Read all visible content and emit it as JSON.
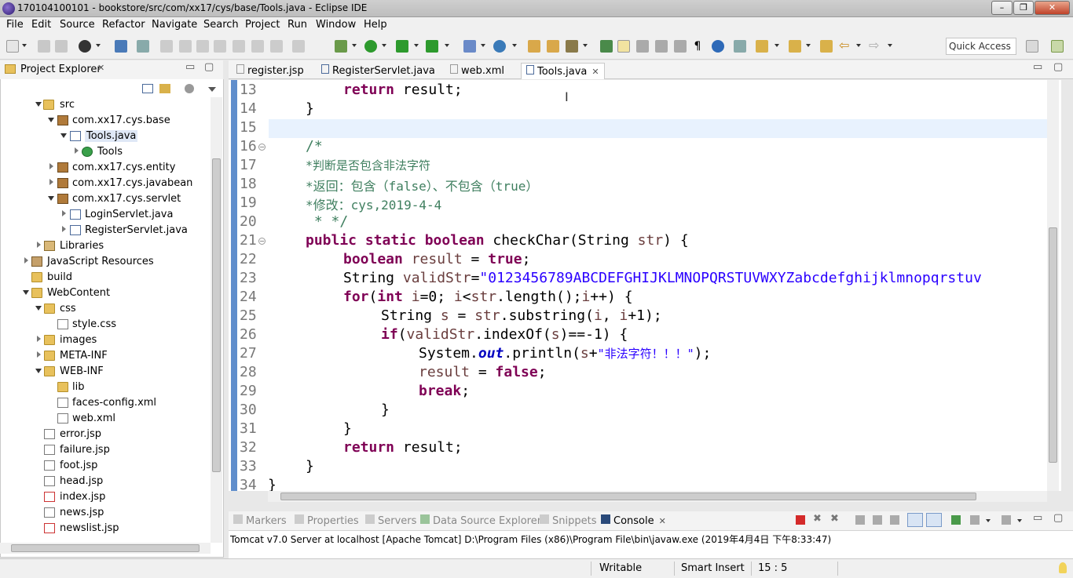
{
  "window": {
    "title": "170104100101 - bookstore/src/com/xx17/cys/base/Tools.java - Eclipse IDE",
    "min": "–",
    "max": "❐",
    "close": "✕"
  },
  "menu": [
    "File",
    "Edit",
    "Source",
    "Refactor",
    "Navigate",
    "Search",
    "Project",
    "Run",
    "Window",
    "Help"
  ],
  "toolbar": {
    "quick_access": "Quick Access"
  },
  "project_explorer": {
    "title": "Project Explorer",
    "tree": [
      {
        "label": "src",
        "icon": "source-folder-icon"
      },
      {
        "label": "com.xx17.cys.base",
        "icon": "package-icon"
      },
      {
        "label": "Tools.java",
        "icon": "java-file-icon"
      },
      {
        "label": "Tools",
        "icon": "class-icon"
      },
      {
        "label": "com.xx17.cys.entity",
        "icon": "package-icon"
      },
      {
        "label": "com.xx17.cys.javabean",
        "icon": "package-icon"
      },
      {
        "label": "com.xx17.cys.servlet",
        "icon": "package-icon"
      },
      {
        "label": "LoginServlet.java",
        "icon": "java-file-icon"
      },
      {
        "label": "RegisterServlet.java",
        "icon": "java-file-icon"
      },
      {
        "label": "Libraries",
        "icon": "library-icon"
      },
      {
        "label": "JavaScript Resources",
        "icon": "js-resources-icon"
      },
      {
        "label": "build",
        "icon": "folder-icon"
      },
      {
        "label": "WebContent",
        "icon": "web-folder-icon"
      },
      {
        "label": "css",
        "icon": "folder-icon"
      },
      {
        "label": "style.css",
        "icon": "css-file-icon"
      },
      {
        "label": "images",
        "icon": "folder-icon"
      },
      {
        "label": "META-INF",
        "icon": "folder-icon"
      },
      {
        "label": "WEB-INF",
        "icon": "folder-icon"
      },
      {
        "label": "lib",
        "icon": "folder-icon"
      },
      {
        "label": "faces-config.xml",
        "icon": "xml-file-icon"
      },
      {
        "label": "web.xml",
        "icon": "xml-file-icon"
      },
      {
        "label": "error.jsp",
        "icon": "jsp-file-icon"
      },
      {
        "label": "failure.jsp",
        "icon": "jsp-file-icon"
      },
      {
        "label": "foot.jsp",
        "icon": "jsp-file-icon"
      },
      {
        "label": "head.jsp",
        "icon": "jsp-file-icon"
      },
      {
        "label": "index.jsp",
        "icon": "jsp-file-icon"
      },
      {
        "label": "news.jsp",
        "icon": "jsp-file-icon"
      },
      {
        "label": "newslist.jsp",
        "icon": "jsp-file-icon"
      }
    ]
  },
  "editor": {
    "tabs": [
      "register.jsp",
      "RegisterServlet.java",
      "web.xml",
      "Tools.java"
    ],
    "active_tab": "Tools.java",
    "line_numbers": [
      "13",
      "14",
      "15",
      "16",
      "17",
      "18",
      "19",
      "20",
      "21",
      "22",
      "23",
      "24",
      "25",
      "26",
      "27",
      "28",
      "29",
      "30",
      "31",
      "32",
      "33",
      "34"
    ],
    "code": {
      "l13_kw": "return",
      "l13_rest": " result;",
      "l14": "}",
      "l16": "/*",
      "l17": "*判断是否包含非法字符",
      "l18": "*返回：包含（false）、不包含（true）",
      "l19": "*修改：cys,2019-4-4",
      "l20": " * */",
      "l21_kw": "public static boolean",
      "l21_rest": " checkChar(String ",
      "l21_var": "str",
      "l21_end": ") {",
      "l22_kw1": "boolean",
      "l22_var": " result",
      "l22_mid": " = ",
      "l22_kw2": "true",
      "l22_end": ";",
      "l23_a": "String ",
      "l23_var": "validStr",
      "l23_eq": "=",
      "l23_str": "\"0123456789ABCDEFGHIJKLMNOPQRSTUVWXYZabcdefghijklmnopqrstuv",
      "l24_kw1": "for",
      "l24_p": "(",
      "l24_kw2": "int",
      "l24_var1": " i",
      "l24_a": "=0; ",
      "l24_var2": "i",
      "l24_b": "<",
      "l24_var3": "str",
      "l24_c": ".length();",
      "l24_var4": "i",
      "l24_d": "++) {",
      "l25_a": "String ",
      "l25_var": "s",
      "l25_b": " = ",
      "l25_var2": "str",
      "l25_c": ".substring(",
      "l25_var3": "i",
      "l25_d": ", ",
      "l25_var4": "i",
      "l25_e": "+1);",
      "l26_kw": "if",
      "l26_a": "(",
      "l26_var": "validStr",
      "l26_b": ".indexOf(",
      "l26_var2": "s",
      "l26_c": ")==-1) {",
      "l27_a": "System.",
      "l27_fld": "out",
      "l27_b": ".println(",
      "l27_var": "s",
      "l27_c": "+",
      "l27_str": "\"非法字符！！！\"",
      "l27_d": ");",
      "l28_var": "result",
      "l28_a": " = ",
      "l28_kw": "false",
      "l28_b": ";",
      "l29_kw": "break",
      "l29_a": ";",
      "l30": "}",
      "l31": "}",
      "l32_kw": "return",
      "l32_rest": " result;",
      "l33": "}",
      "l34": "}"
    }
  },
  "console": {
    "tabs": [
      "Markers",
      "Properties",
      "Servers",
      "Data Source Explorer",
      "Snippets",
      "Console"
    ],
    "active_tab": "Console",
    "text": "Tomcat v7.0 Server at localhost [Apache Tomcat] D:\\Program Files (x86)\\Program File\\bin\\javaw.exe (2019年4月4日 下午8:33:47)"
  },
  "status": {
    "writable": "Writable",
    "insert_mode": "Smart Insert",
    "position": "15 : 5"
  }
}
